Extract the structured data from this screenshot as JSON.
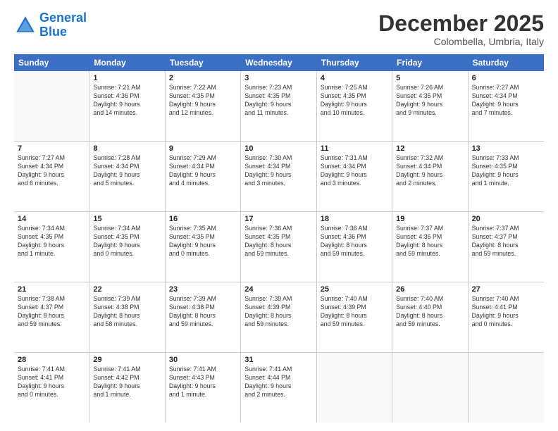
{
  "header": {
    "logo_line1": "General",
    "logo_line2": "Blue",
    "month": "December 2025",
    "location": "Colombella, Umbria, Italy"
  },
  "weekdays": [
    "Sunday",
    "Monday",
    "Tuesday",
    "Wednesday",
    "Thursday",
    "Friday",
    "Saturday"
  ],
  "rows": [
    [
      {
        "day": "",
        "info": ""
      },
      {
        "day": "1",
        "info": "Sunrise: 7:21 AM\nSunset: 4:36 PM\nDaylight: 9 hours\nand 14 minutes."
      },
      {
        "day": "2",
        "info": "Sunrise: 7:22 AM\nSunset: 4:35 PM\nDaylight: 9 hours\nand 12 minutes."
      },
      {
        "day": "3",
        "info": "Sunrise: 7:23 AM\nSunset: 4:35 PM\nDaylight: 9 hours\nand 11 minutes."
      },
      {
        "day": "4",
        "info": "Sunrise: 7:25 AM\nSunset: 4:35 PM\nDaylight: 9 hours\nand 10 minutes."
      },
      {
        "day": "5",
        "info": "Sunrise: 7:26 AM\nSunset: 4:35 PM\nDaylight: 9 hours\nand 9 minutes."
      },
      {
        "day": "6",
        "info": "Sunrise: 7:27 AM\nSunset: 4:34 PM\nDaylight: 9 hours\nand 7 minutes."
      }
    ],
    [
      {
        "day": "7",
        "info": "Sunrise: 7:27 AM\nSunset: 4:34 PM\nDaylight: 9 hours\nand 6 minutes."
      },
      {
        "day": "8",
        "info": "Sunrise: 7:28 AM\nSunset: 4:34 PM\nDaylight: 9 hours\nand 5 minutes."
      },
      {
        "day": "9",
        "info": "Sunrise: 7:29 AM\nSunset: 4:34 PM\nDaylight: 9 hours\nand 4 minutes."
      },
      {
        "day": "10",
        "info": "Sunrise: 7:30 AM\nSunset: 4:34 PM\nDaylight: 9 hours\nand 3 minutes."
      },
      {
        "day": "11",
        "info": "Sunrise: 7:31 AM\nSunset: 4:34 PM\nDaylight: 9 hours\nand 3 minutes."
      },
      {
        "day": "12",
        "info": "Sunrise: 7:32 AM\nSunset: 4:34 PM\nDaylight: 9 hours\nand 2 minutes."
      },
      {
        "day": "13",
        "info": "Sunrise: 7:33 AM\nSunset: 4:35 PM\nDaylight: 9 hours\nand 1 minute."
      }
    ],
    [
      {
        "day": "14",
        "info": "Sunrise: 7:34 AM\nSunset: 4:35 PM\nDaylight: 9 hours\nand 1 minute."
      },
      {
        "day": "15",
        "info": "Sunrise: 7:34 AM\nSunset: 4:35 PM\nDaylight: 9 hours\nand 0 minutes."
      },
      {
        "day": "16",
        "info": "Sunrise: 7:35 AM\nSunset: 4:35 PM\nDaylight: 9 hours\nand 0 minutes."
      },
      {
        "day": "17",
        "info": "Sunrise: 7:36 AM\nSunset: 4:35 PM\nDaylight: 8 hours\nand 59 minutes."
      },
      {
        "day": "18",
        "info": "Sunrise: 7:36 AM\nSunset: 4:36 PM\nDaylight: 8 hours\nand 59 minutes."
      },
      {
        "day": "19",
        "info": "Sunrise: 7:37 AM\nSunset: 4:36 PM\nDaylight: 8 hours\nand 59 minutes."
      },
      {
        "day": "20",
        "info": "Sunrise: 7:37 AM\nSunset: 4:37 PM\nDaylight: 8 hours\nand 59 minutes."
      }
    ],
    [
      {
        "day": "21",
        "info": "Sunrise: 7:38 AM\nSunset: 4:37 PM\nDaylight: 8 hours\nand 59 minutes."
      },
      {
        "day": "22",
        "info": "Sunrise: 7:39 AM\nSunset: 4:38 PM\nDaylight: 8 hours\nand 58 minutes."
      },
      {
        "day": "23",
        "info": "Sunrise: 7:39 AM\nSunset: 4:38 PM\nDaylight: 8 hours\nand 59 minutes."
      },
      {
        "day": "24",
        "info": "Sunrise: 7:39 AM\nSunset: 4:39 PM\nDaylight: 8 hours\nand 59 minutes."
      },
      {
        "day": "25",
        "info": "Sunrise: 7:40 AM\nSunset: 4:39 PM\nDaylight: 8 hours\nand 59 minutes."
      },
      {
        "day": "26",
        "info": "Sunrise: 7:40 AM\nSunset: 4:40 PM\nDaylight: 8 hours\nand 59 minutes."
      },
      {
        "day": "27",
        "info": "Sunrise: 7:40 AM\nSunset: 4:41 PM\nDaylight: 9 hours\nand 0 minutes."
      }
    ],
    [
      {
        "day": "28",
        "info": "Sunrise: 7:41 AM\nSunset: 4:41 PM\nDaylight: 9 hours\nand 0 minutes."
      },
      {
        "day": "29",
        "info": "Sunrise: 7:41 AM\nSunset: 4:42 PM\nDaylight: 9 hours\nand 1 minute."
      },
      {
        "day": "30",
        "info": "Sunrise: 7:41 AM\nSunset: 4:43 PM\nDaylight: 9 hours\nand 1 minute."
      },
      {
        "day": "31",
        "info": "Sunrise: 7:41 AM\nSunset: 4:44 PM\nDaylight: 9 hours\nand 2 minutes."
      },
      {
        "day": "",
        "info": ""
      },
      {
        "day": "",
        "info": ""
      },
      {
        "day": "",
        "info": ""
      }
    ]
  ]
}
